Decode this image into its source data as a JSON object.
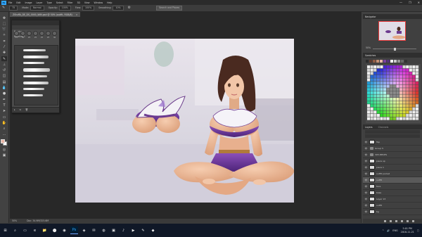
{
  "menu": {
    "logo": "Ps",
    "items": [
      "File",
      "Edit",
      "Image",
      "Layer",
      "Type",
      "Select",
      "Filter",
      "3D",
      "View",
      "Window",
      "Help"
    ]
  },
  "window_controls": {
    "minimize": "—",
    "maximize": "❐",
    "close": "✕"
  },
  "options_bar": {
    "size": "75",
    "mode_label": "Mode:",
    "mode_value": "Normal",
    "opacity_label": "Opacity:",
    "opacity_value": "100%",
    "flow_label": "Flow:",
    "flow_value": "100%",
    "smoothing_label": "Smoothing:",
    "smoothing_value": "10%",
    "search_label": "Search and Places"
  },
  "document": {
    "tab_title": "ZStuffA_DE_DS_0000_WIN.psd @ 50% (outfit, RGB/8)",
    "tab_close": "×"
  },
  "status": {
    "zoom": "50%",
    "doc_info": "Doc: 34.9M/325.6M"
  },
  "brushes_panel": {
    "title": "Brushes",
    "sub": "Brushes 1",
    "tip_sizes": [
      "25",
      "50",
      "25",
      "25",
      "25",
      "25",
      "36"
    ],
    "foot": [
      "▸",
      "⧉",
      "🗑"
    ]
  },
  "navigator": {
    "title": "Navigator",
    "zoom": "50%"
  },
  "swatches": {
    "title": "Swatches",
    "recent": [
      "#2b2b2b",
      "#5d3a2f",
      "#8f5b44",
      "#c79174",
      "#e8b4a4",
      "#7a3fa0",
      "#53307a",
      "#ffffff",
      "#cccccc",
      "#999999",
      "#666666",
      "#333333"
    ]
  },
  "layers": {
    "tabs": [
      "Layers",
      "Channels"
    ],
    "items": [
      {
        "name": "Top",
        "type": "layer"
      },
      {
        "name": "Group 5",
        "type": "group"
      },
      {
        "name": "305 PIECES",
        "type": "group"
      },
      {
        "name": "piece up",
        "type": "layer"
      },
      {
        "name": "piece 1",
        "type": "layer"
      },
      {
        "name": "outfit pocket",
        "type": "layer"
      },
      {
        "name": "outfit",
        "type": "layer",
        "selected": true
      },
      {
        "name": "face",
        "type": "layer"
      },
      {
        "name": "base",
        "type": "layer"
      },
      {
        "name": "Layer 13",
        "type": "layer"
      },
      {
        "name": "outfit",
        "type": "layer"
      },
      {
        "name": "bg",
        "type": "layer"
      }
    ]
  },
  "taskbar": {
    "apps": [
      "⊞",
      "⌕",
      "▭",
      "e",
      "📁",
      "⬤",
      "◉",
      "Ps",
      "◈",
      "✉",
      "◍",
      "▣",
      "♪",
      "▶",
      "✎",
      "◆"
    ],
    "tray": [
      "^",
      "🔊",
      "ENG"
    ],
    "time": "5:01 PM",
    "date": "2018-11-21"
  }
}
